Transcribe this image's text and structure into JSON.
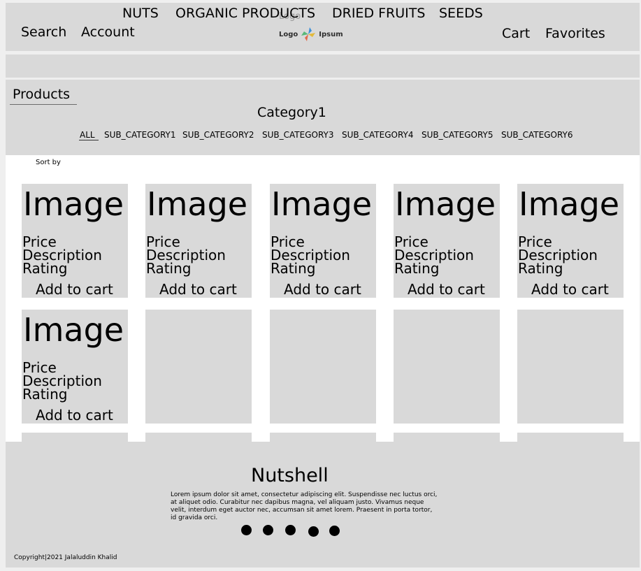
{
  "header": {
    "search_label": "Search",
    "account_label": "Account",
    "logo_placeholder": "Logo",
    "logo_left": "Logo",
    "logo_right": "Ipsum",
    "cart_label": "Cart",
    "favorites_label": "Favorites"
  },
  "category_nav": [
    "NUTS",
    "ORGANIC PRODUCTS",
    "DRIED FRUITS",
    "SEEDS"
  ],
  "products": {
    "title": "Products",
    "category_title": "Category1",
    "subcategories": [
      "ALL",
      "SUB_CATEGORY1",
      "SUB_CATEGORY2",
      "SUB_CATEGORY3",
      "SUB_CATEGORY4",
      "SUB_CATEGORY5",
      "SUB_CATEGORY6"
    ],
    "sort_label": "Sort by"
  },
  "card": {
    "image_label": "Image",
    "price_label": "Price",
    "description_label": "Description",
    "rating_label": "Rating",
    "cart_label": "Add to cart"
  },
  "footer": {
    "title": "Nutshell",
    "body": "Lorem ipsum dolor sit amet, consectetur adipiscing elit. Suspendisse nec luctus orci, at aliquet odio. Curabitur nec dapibus magna, vel aliquam justo. Vivamus neque velit, interdum eget auctor nec, accumsan sit amet lorem. Praesent in porta tortor, id gravida orci.",
    "copyright": "Copyright|2021 Jalaluddin Khalid"
  },
  "colors": {
    "panel": "#d9d9d9",
    "page": "#efefef",
    "content": "#ffffff"
  }
}
